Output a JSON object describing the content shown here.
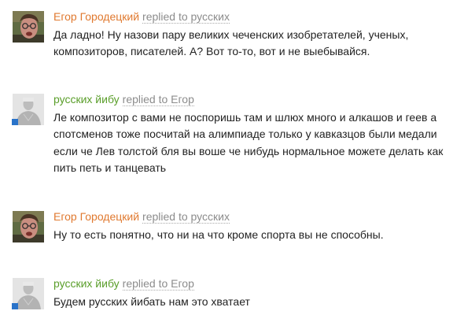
{
  "comments": [
    {
      "author": "Егор Городецкий",
      "reply": "replied to русских",
      "text": "Да ладно! Ну назови пару великих чеченских изобретателей, ученых, композиторов, писателей. А? Вот то-то, вот и не выебывайся."
    },
    {
      "author": "русских йибу",
      "reply": "replied to Егор",
      "text": "Ле композитор с вами не поспоришь там и шлюх много и алкашов и геев а спотсменов тоже посчитай на алимпиаде только у кавказцов были медали если че Лев толстой бля вы воше че нибудь нормальное можете делать как пить петь и танцевать"
    },
    {
      "author": "Егор Городецкий",
      "reply": "replied to русских",
      "text": "Ну то есть понятно, что ни на что кроме спорта вы не способны."
    },
    {
      "author": "русских йибу",
      "reply": "replied to Егор",
      "text": "Будем русских йибать нам это хватает"
    }
  ],
  "colors": {
    "author_egor": "#e0792f",
    "author_russkih": "#5a9e2a",
    "reply_text": "#8c8c8c",
    "body_text": "#222222",
    "presence_badge": "#2a73c9"
  },
  "icons": {
    "egor_avatar": "user-photo-avatar",
    "russkih_avatar": "default-silhouette-avatar",
    "presence": "online-status-badge"
  }
}
